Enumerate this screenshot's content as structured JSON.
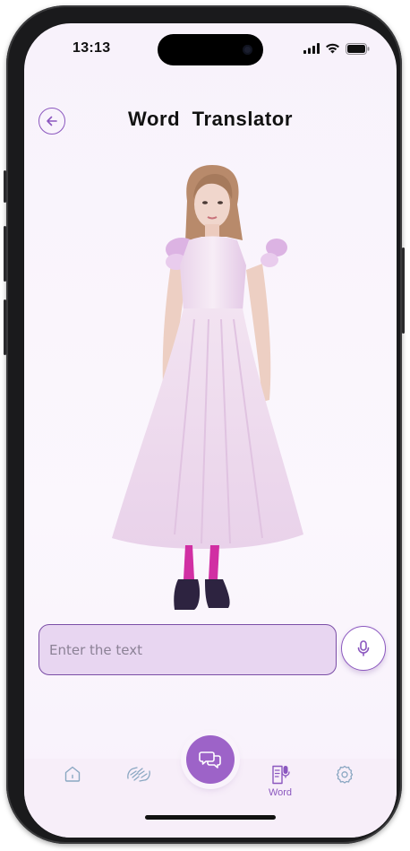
{
  "status_bar": {
    "time": "13:13",
    "icons": [
      "cellular-signal-icon",
      "wifi-icon",
      "battery-icon"
    ]
  },
  "header": {
    "title": "Word  Translator",
    "back_icon": "arrow-left-icon"
  },
  "avatar": {
    "description": "sign-language-avatar"
  },
  "input": {
    "placeholder": "Enter the text",
    "value": ""
  },
  "mic_button": {
    "icon": "microphone-icon"
  },
  "tab_bar": {
    "tabs": [
      {
        "icon": "home-icon",
        "label": ""
      },
      {
        "icon": "sign-hands-icon",
        "label": ""
      },
      {
        "icon": "word-icon",
        "label": "Word",
        "active": true
      },
      {
        "icon": "settings-icon",
        "label": ""
      }
    ],
    "center_button_icon": "chat-bubbles-icon"
  },
  "colors": {
    "accent": "#8b57bf",
    "input_bg": "#e8d6f1",
    "fab": "#9d63c8",
    "tab_icon": "#8aa7c2"
  }
}
